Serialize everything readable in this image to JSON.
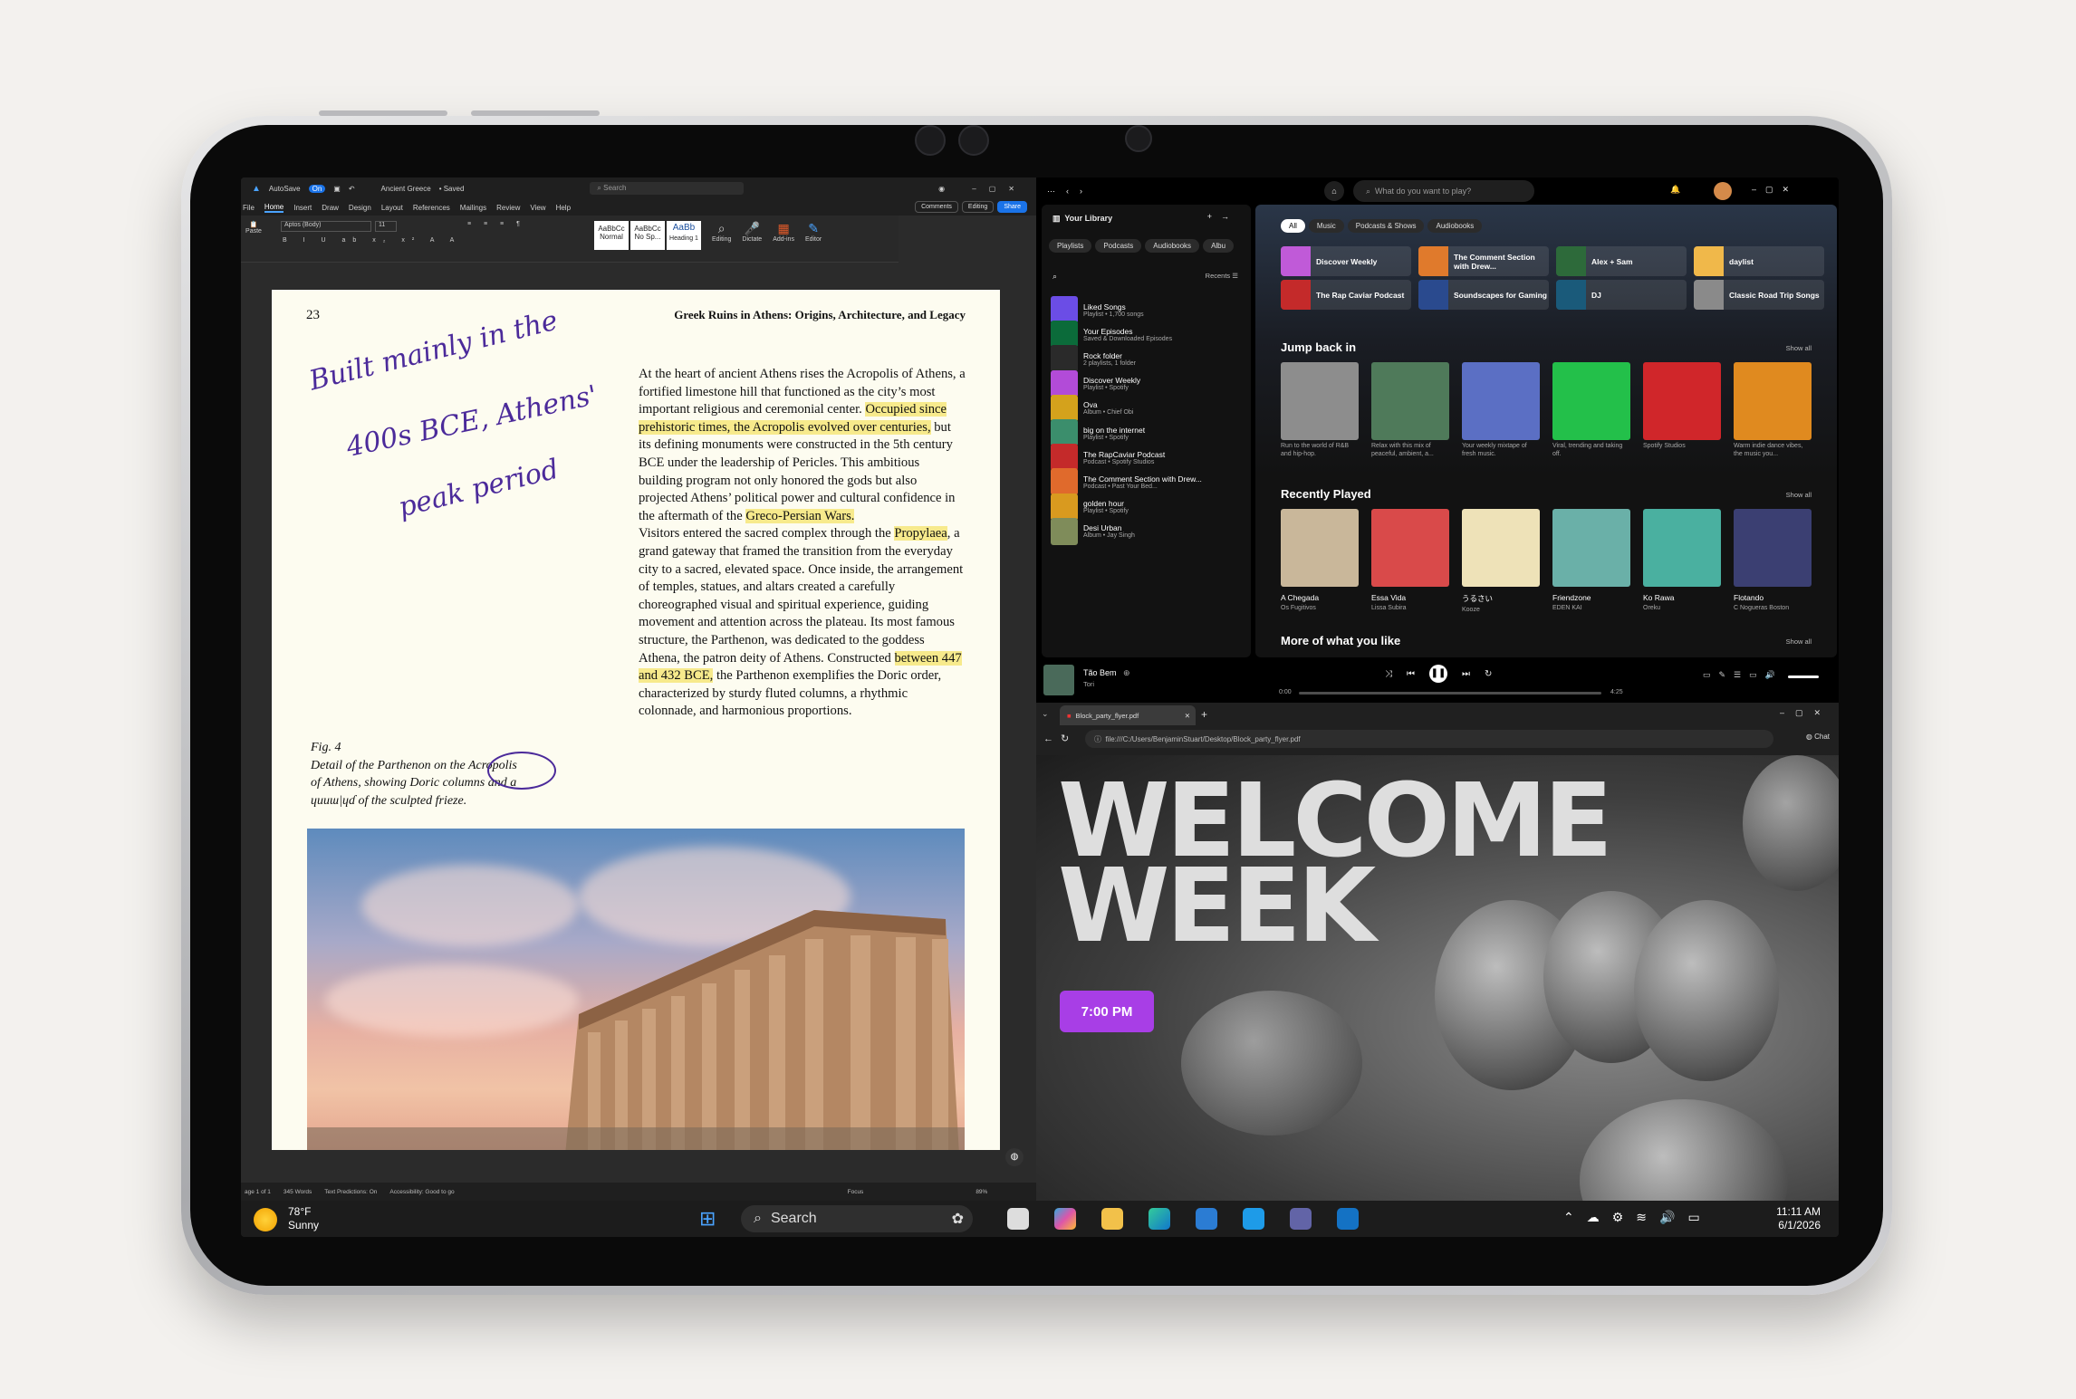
{
  "word": {
    "title": "Ancient Greece",
    "autosave": "AutoSave",
    "autosave_state": "On",
    "saved": "• Saved",
    "search": "Search",
    "tabs": [
      "File",
      "Home",
      "Insert",
      "Draw",
      "Design",
      "Layout",
      "References",
      "Mailings",
      "Review",
      "View",
      "Help"
    ],
    "buttons": {
      "comments": "Comments",
      "editing": "Editing",
      "share": "Share"
    },
    "ribbon": {
      "font": "Aptos (Body)",
      "size": "11",
      "styles": [
        "Normal",
        "No Sp...",
        "Heading 1"
      ],
      "style_sample": "AaBbCc",
      "heading_sample": "AaBb",
      "groups": [
        "Paste",
        "Editing",
        "Dictate",
        "Add-ins",
        "Editor"
      ]
    },
    "page_number": "23",
    "page_header": "Greek Ruins in Athens: Origins, Architecture, and Legacy",
    "handwriting": [
      "Built mainly in the",
      "400s BCE, Athens'",
      "peak period"
    ],
    "caption": [
      "Fig. 4",
      "Detail of the Parthenon on the Acropolis",
      "of Athens, showing Doric columns and a",
      "ɥuuɯ|ɥɗ of the sculpted frieze."
    ],
    "paragraph1": {
      "a": "At the heart of ancient Athens rises the Acropolis of Athens, a fortified limestone hill that functioned as the city’s most important religious and ceremonial center. ",
      "h1": "Occupied since prehistoric times, the Acropolis evolved over centuries,",
      "b": " but its defining monuments were constructed in the 5th century BCE under the leadership of Pericles. This ambitious building program not only honored the gods but also projected Athens’ political power and cultural confidence in the aftermath of the ",
      "h2": "Greco-Persian Wars."
    },
    "paragraph2": {
      "a": "Visitors entered the sacred complex through the ",
      "h1": "Propylaea",
      "b": ", a grand gateway that framed the transition from the everyday city to a sacred, elevated space. Once inside, the arrangement of temples, statues, and altars created a carefully choreographed visual and spiritual experience, guiding movement and attention across the plateau. Its most famous structure, the Parthenon, was dedicated to the goddess Athena, the patron deity of Athens. Constructed ",
      "h2": "between 447 and 432 BCE,",
      "c": " the Parthenon exemplifies the Doric order, characterized by sturdy fluted columns, a rhythmic colonnade, and harmonious proportions."
    },
    "status": [
      "age 1 of 1",
      "345 Words",
      "Text Predictions: On",
      "Accessibility: Good to go",
      "Focus",
      "89%"
    ]
  },
  "spotify": {
    "search": "What do you want to play?",
    "library_title": "Your Library",
    "lib_chips": [
      "Playlists",
      "Podcasts",
      "Audiobooks",
      "Albu"
    ],
    "recents": "Recents",
    "library": [
      {
        "t": "Liked Songs",
        "s": "Playlist • 1,700 songs",
        "c": "#6b4de6"
      },
      {
        "t": "Your Episodes",
        "s": "Saved & Downloaded Episodes",
        "c": "#0b6b3a"
      },
      {
        "t": "Rock folder",
        "s": "2 playlists, 1 folder",
        "c": "#2a2a2a"
      },
      {
        "t": "Discover Weekly",
        "s": "Playlist • Spotify",
        "c": "#b24bd8"
      },
      {
        "t": "Ova",
        "s": "Album • Chief Obi",
        "c": "#d4a21c"
      },
      {
        "t": "big on the internet",
        "s": "Playlist • Spotify",
        "c": "#3b8e6c"
      },
      {
        "t": "The RapCaviar Podcast",
        "s": "Podcast • Spotify Studios",
        "c": "#c42a2a"
      },
      {
        "t": "The Comment Section with Drew...",
        "s": "Podcast • Past Your Bed...",
        "c": "#e06a2c"
      },
      {
        "t": "golden hour",
        "s": "Playlist • Spotify",
        "c": "#d99a1f"
      },
      {
        "t": "Desi Urban",
        "s": "Album • Jay Singh",
        "c": "#7f8c5a"
      }
    ],
    "filters": [
      "All",
      "Music",
      "Podcasts & Shows",
      "Audiobooks"
    ],
    "shortcuts": [
      {
        "t": "Discover Weekly",
        "c": "#c05ad8"
      },
      {
        "t": "The Comment Section with Drew...",
        "c": "#e07a2c"
      },
      {
        "t": "Alex + Sam",
        "c": "#2d6a3a"
      },
      {
        "t": "daylist",
        "c": "#f0b84a"
      },
      {
        "t": "The Rap Caviar Podcast",
        "c": "#c42a2a"
      },
      {
        "t": "Soundscapes for Gaming",
        "c": "#2a4a8e"
      },
      {
        "t": "DJ",
        "c": "#1a5a7a"
      },
      {
        "t": "Classic Road Trip Songs",
        "c": "#8a8a8a"
      }
    ],
    "jump_title": "Jump back in",
    "show_all": "Show all",
    "jump": [
      {
        "d": "Run to the world of R&B and hip-hop.",
        "c": "#8d8d8d"
      },
      {
        "d": "Relax with this mix of peaceful, ambient, a...",
        "c": "#4f7a5a"
      },
      {
        "d": "Your weekly mixtape of fresh music.",
        "c": "#5b6fc4"
      },
      {
        "d": "Viral, trending and taking off.",
        "c": "#23c04a"
      },
      {
        "d": "Spotify Studios",
        "c": "#d0262a"
      },
      {
        "d": "Warm indie dance vibes, the music you...",
        "c": "#e08a1f"
      }
    ],
    "recent_title": "Recently Played",
    "recent": [
      {
        "n": "A Chegada",
        "d": "Os Fugitivos",
        "c": "#c9b79a"
      },
      {
        "n": "Essa Vida",
        "d": "Lissa Subira",
        "c": "#d94a4a"
      },
      {
        "n": "うるさい",
        "d": "Kooze",
        "c": "#eee2b8"
      },
      {
        "n": "Friendzone",
        "d": "EDEN KAI",
        "c": "#6ab0a8"
      },
      {
        "n": "Ko Rawa",
        "d": "Oreku",
        "c": "#4ab0a0"
      },
      {
        "n": "Flotando",
        "d": "C Nogueras Boston",
        "c": "#3b3f72"
      }
    ],
    "more_title": "More of what you like",
    "now_playing": {
      "title": "Tão Bem",
      "artist": "Tori",
      "elapsed": "0:00",
      "duration": "4:25",
      "progress": 0.0
    }
  },
  "edge": {
    "tab": "Block_party_flyer.pdf",
    "url": "file:///C:/Users/BenjaminStuart/Desktop/Block_party_flyer.pdf",
    "chat": "Chat",
    "flyer_line1": "WELCOME",
    "flyer_line2": "WEEK",
    "flyer_time": "7:00 PM"
  },
  "taskbar": {
    "temp": "78°F",
    "weather": "Sunny",
    "search": "Search",
    "time": "11:11 AM",
    "date": "6/1/2026"
  }
}
